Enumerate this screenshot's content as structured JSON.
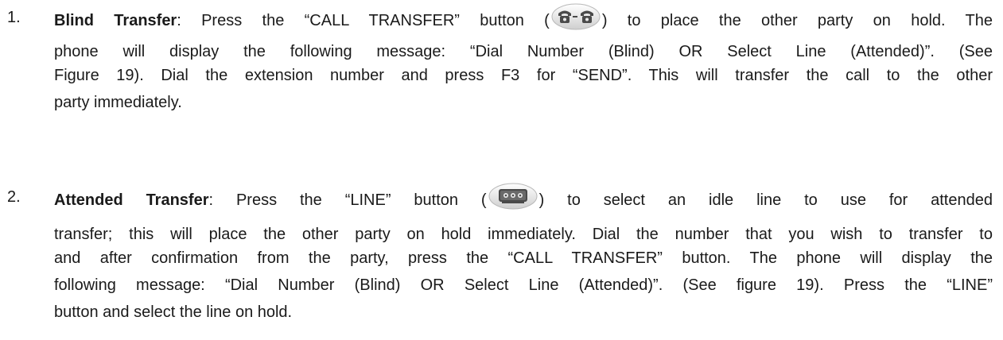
{
  "items": [
    {
      "number": "1.",
      "title": "Blind Transfer",
      "icon": "call-transfer-key-icon",
      "line1_a": ": Press the “CALL TRANSFER” button (",
      "line1_b": ") to place the other party on hold. The",
      "line2": "phone will display the following message: “Dial Number (Blind) OR Select Line (Attended)”. (See",
      "line3": "Figure 19). Dial the extension number and press F3 for “SEND”. This will transfer the call to the other",
      "line4": "party immediately."
    },
    {
      "number": "2.",
      "title": "Attended Transfer",
      "icon": "line-key-icon",
      "line1_a": ": Press the “LINE” button (",
      "line1_b": ") to select an idle line to use for attended",
      "line2": "transfer; this will place the other party on hold immediately. Dial the number that you wish to transfer to",
      "line3": "and after confirmation from the party, press the “CALL TRANSFER” button. The phone will display the",
      "line4": "following message: “Dial Number (Blind) OR Select Line (Attended)”. (See figure 19). Press the “LINE”",
      "line5": "button and select the line on hold."
    }
  ],
  "colors": {
    "text": "#1a1a1a",
    "key_face": "#e9e9e9",
    "key_symbol": "#4a4a4a"
  }
}
